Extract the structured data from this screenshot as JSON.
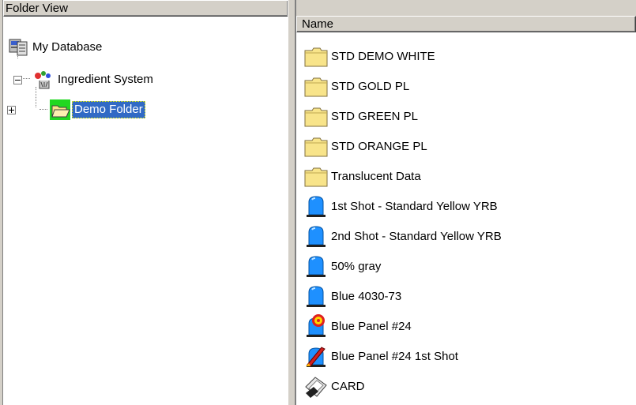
{
  "left_pane": {
    "header": "Folder View",
    "tree": [
      {
        "label": "My Database",
        "icon": "database-icon",
        "expander": "none"
      },
      {
        "label": "Ingredient System",
        "icon": "ingredient-system-icon",
        "expander": "minus"
      },
      {
        "label": "Demo Folder",
        "icon": "open-folder-icon",
        "expander": "plus",
        "selected": true
      }
    ]
  },
  "right_pane": {
    "header": "Name",
    "items": [
      {
        "label": "STD DEMO WHITE",
        "icon": "folder-icon"
      },
      {
        "label": "STD GOLD PL",
        "icon": "folder-icon"
      },
      {
        "label": "STD GREEN PL",
        "icon": "folder-icon"
      },
      {
        "label": "STD ORANGE PL",
        "icon": "folder-icon"
      },
      {
        "label": "Translucent Data",
        "icon": "folder-icon"
      },
      {
        "label": "1st Shot - Standard Yellow YRB",
        "icon": "standard-sample-icon"
      },
      {
        "label": "2nd Shot - Standard Yellow YRB",
        "icon": "standard-sample-icon"
      },
      {
        "label": "50% gray",
        "icon": "standard-sample-icon"
      },
      {
        "label": "Blue 4030-73",
        "icon": "standard-sample-icon"
      },
      {
        "label": "Blue Panel #24",
        "icon": "flagged-sample-icon"
      },
      {
        "label": "Blue Panel #24 1st Shot",
        "icon": "rocket-sample-icon"
      },
      {
        "label": "CARD",
        "icon": "card-icon"
      }
    ]
  },
  "colors": {
    "selection": "#316ac5",
    "folder_yellow": "#f8e48a",
    "sample_blue": "#1e90ff"
  }
}
